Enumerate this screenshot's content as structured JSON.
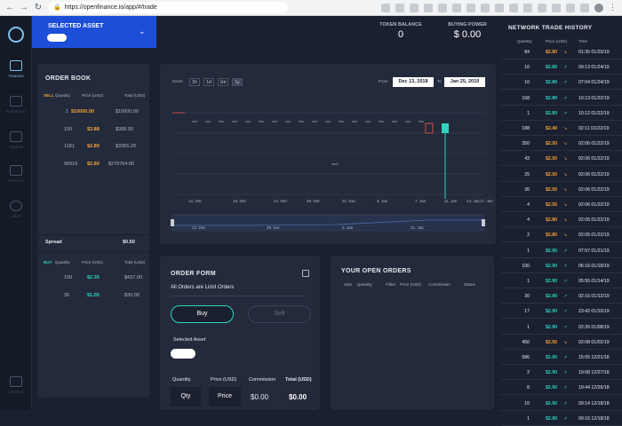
{
  "browser": {
    "url": "https://openfinance.io/app/#/trade",
    "back": "←",
    "forward": "→",
    "reload": "↻",
    "secure": "🔒"
  },
  "sidebar": {
    "items": [
      "TRADING",
      "PORTFOLIO",
      "TOKENS",
      "PROFILE",
      "HELP",
      "LOGOUT"
    ]
  },
  "asset": {
    "label": "SELECTED ASSET",
    "chevron": "⌄"
  },
  "stats": [
    {
      "label": "TOKEN BALANCE",
      "value": "0"
    },
    {
      "label": "BUYING POWER",
      "value": "$ 0.00"
    }
  ],
  "orderbook": {
    "title": "ORDER BOOK",
    "headers": [
      "Quantity",
      "Price (USD)",
      "Total (USD)"
    ],
    "sell_label": "SELL",
    "buy_label": "BUY",
    "sell": [
      {
        "q": "1",
        "p": "$10000.00",
        "t": "$10000.00"
      },
      {
        "q": "100",
        "p": "$3.88",
        "t": "$388.00"
      },
      {
        "q": "1181",
        "p": "$2.89",
        "t": "$3355.29"
      },
      {
        "q": "99916",
        "p": "$2.80",
        "t": "$278764.80"
      }
    ],
    "spread_label": "Spread",
    "spread_value": "$0.50",
    "buy": [
      {
        "q": "190",
        "p": "$2.30",
        "t": "$437.00"
      },
      {
        "q": "30",
        "p": "$1.00",
        "t": "$30.00"
      }
    ]
  },
  "chart": {
    "zoom_label": "Zoom",
    "zooms": [
      "1h",
      "1d",
      "1m",
      "1y"
    ],
    "from_label": "From",
    "from": "Dec 13, 2018",
    "to_label": "To",
    "to": "Jan 25, 2019",
    "x_ticks": [
      "14. Dec",
      "18. Dec",
      "24. Dec",
      "28. Dec",
      "31. Dec",
      "3. Jan",
      "7. Jan",
      "11. Jan",
      "14. Jan",
      "17. Jan",
      "21. Jan",
      "24. Jan",
      "28"
    ],
    "nav_ticks": [
      "14. Dec",
      "28. Dec",
      "3. Jan",
      "21. Jan"
    ]
  },
  "orderform": {
    "title": "ORDER FORM",
    "subtitle": "All Orders are Limit Orders",
    "buy": "Buy",
    "sell": "Sell",
    "selected_asset": "Selected Asset",
    "headers": [
      "Quantity",
      "Price (USD)",
      "Commission",
      "Total (USD)"
    ],
    "qty_placeholder": "Qty",
    "price_placeholder": "Price",
    "commission": "$0.00",
    "total": "$0.00"
  },
  "openorders": {
    "title": "YOUR OPEN ORDERS",
    "headers": [
      "Side",
      "Quantity",
      "Filled",
      "Price (USD)",
      "Commission",
      "Status"
    ]
  },
  "history": {
    "title": "NETWORK TRADE HISTORY",
    "headers": [
      "Quantity",
      "Price (USD)",
      "Time"
    ],
    "rows": [
      {
        "q": "84",
        "p": "$2.80",
        "d": "down",
        "t": "01:35 01/25/19"
      },
      {
        "q": "16",
        "p": "$2.89",
        "d": "up",
        "t": "09:13 01/24/19"
      },
      {
        "q": "10",
        "p": "$2.89",
        "d": "up",
        "t": "07:04 01/24/19"
      },
      {
        "q": "168",
        "p": "$2.89",
        "d": "up",
        "t": "10:13 01/22/19"
      },
      {
        "q": "1",
        "p": "$2.89",
        "d": "up",
        "t": "10:12 01/22/19"
      },
      {
        "q": "188",
        "p": "$2.40",
        "d": "down",
        "t": "02:11 01/22/19"
      },
      {
        "q": "350",
        "p": "$2.50",
        "d": "down",
        "t": "02:06 01/22/19"
      },
      {
        "q": "43",
        "p": "$2.50",
        "d": "down",
        "t": "02:06 01/22/19"
      },
      {
        "q": "25",
        "p": "$2.50",
        "d": "down",
        "t": "02:06 01/22/19"
      },
      {
        "q": "30",
        "p": "$2.50",
        "d": "down",
        "t": "02:06 01/22/19"
      },
      {
        "q": "4",
        "p": "$2.55",
        "d": "down",
        "t": "02:06 01/22/19"
      },
      {
        "q": "4",
        "p": "$2.80",
        "d": "down",
        "t": "02:05 01/22/19"
      },
      {
        "q": "2",
        "p": "$2.80",
        "d": "down",
        "t": "02:05 01/22/19"
      },
      {
        "q": "1",
        "p": "$2.90",
        "d": "up",
        "t": "07:57 01/21/19"
      },
      {
        "q": "100",
        "p": "$2.90",
        "d": "up",
        "t": "06:16 01/18/19"
      },
      {
        "q": "1",
        "p": "$2.90",
        "d": "up",
        "t": "05:55 01/14/19"
      },
      {
        "q": "30",
        "p": "$2.90",
        "d": "up",
        "t": "02:16 01/12/19"
      },
      {
        "q": "17",
        "p": "$2.90",
        "d": "up",
        "t": "23:42 01/10/19"
      },
      {
        "q": "1",
        "p": "$2.90",
        "d": "up",
        "t": "02:26 01/08/19"
      },
      {
        "q": "450",
        "p": "$2.50",
        "d": "down",
        "t": "02:08 01/02/19"
      },
      {
        "q": "586",
        "p": "$2.90",
        "d": "up",
        "t": "15:05 12/21/18"
      },
      {
        "q": "2",
        "p": "$2.90",
        "d": "up",
        "t": "19:08 12/27/18"
      },
      {
        "q": "8",
        "p": "$2.90",
        "d": "up",
        "t": "19:44 12/26/18"
      },
      {
        "q": "10",
        "p": "$2.90",
        "d": "up",
        "t": "09:14 12/18/18"
      },
      {
        "q": "1",
        "p": "$2.90",
        "d": "up",
        "t": "09:16 12/18/18"
      }
    ]
  },
  "colors": {
    "up": "#2dd4bf",
    "down": "#f2a33a",
    "accent": "#1d4ed8"
  }
}
